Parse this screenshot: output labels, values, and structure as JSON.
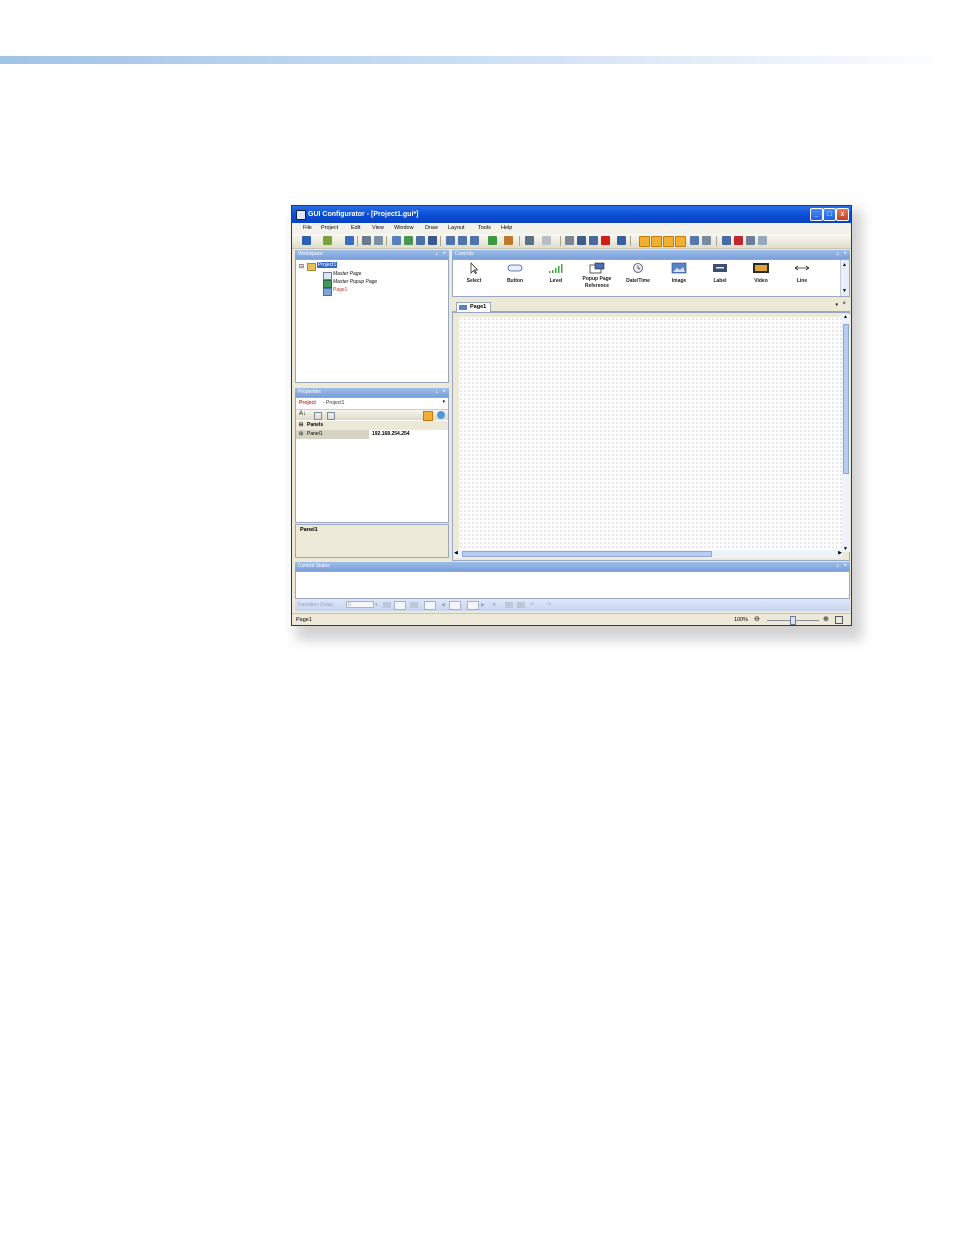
{
  "window": {
    "title": "GUI Configurator - [Project1.gui*]",
    "buttons": [
      "_",
      "□",
      "x"
    ]
  },
  "menu": [
    "File",
    "Project",
    "Edit",
    "View",
    "Window",
    "Draw",
    "Layout",
    "Tools",
    "Help"
  ],
  "workspace": {
    "title": "Workspace",
    "tree": {
      "root": "Project1",
      "children": [
        "Master Page",
        "Master Popup Page",
        "Page1"
      ]
    }
  },
  "properties": {
    "title": "Properties",
    "selector_bold": "Project",
    "selector_rest": " - Project1",
    "group": "Panels",
    "row_name": "Panel1",
    "row_value": "192.168.254.254",
    "description": "Panel1"
  },
  "controls": {
    "title": "Controls",
    "items": [
      "Select",
      "Button",
      "Level",
      "Popup Page Reference",
      "Date/Time",
      "Image",
      "Label",
      "Video",
      "Line"
    ]
  },
  "document_tab": "Page1",
  "control_states": {
    "title": "Control States",
    "transition_label": "Transition Delay:",
    "transition_value": "0"
  },
  "status": {
    "page": "Page1",
    "zoom": "100%"
  },
  "colors": {
    "title_bar": "#0a4fd6",
    "panel_header": "#7b9fd9",
    "chrome": "#ece9d8",
    "accent_band": "#9fc3e8"
  }
}
